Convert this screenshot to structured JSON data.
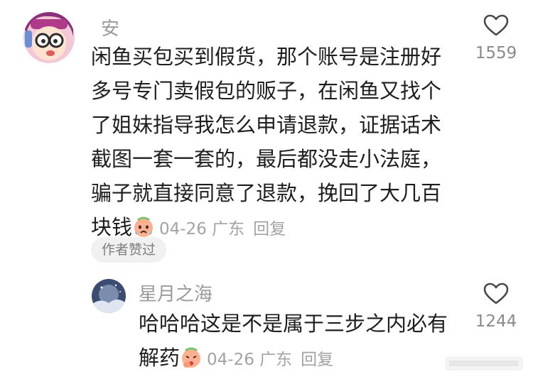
{
  "comments": [
    {
      "username": "安",
      "text_lines": [
        "闲鱼买包买到假货，那个账号是注册好",
        "多号专门卖假包的贩子，在闲鱼又找个",
        "了姐妹指导我怎么申请退款，证据话术",
        "截图一套一套的，最后都没走小法庭，",
        "骗子就直接同意了退款，挽回了大几百",
        "块钱"
      ],
      "emoji": "crying-face-emoji",
      "date": "04-26",
      "location": "广东",
      "reply_label": "回复",
      "likes": "1559",
      "badge": "作者赞过"
    },
    {
      "username": "星月之海",
      "text_lines": [
        "哈哈哈这是不是属于三步之内必有",
        "解药"
      ],
      "emoji": "thinking-face-emoji",
      "date": "04-26",
      "location": "广东",
      "reply_label": "回复",
      "likes": "1244"
    }
  ],
  "icons": {
    "like": "heart-outline-icon"
  },
  "colors": {
    "text": "#1e1e1e",
    "meta": "#a3a3a3",
    "badge_bg": "#f1f1f1",
    "emoji_face": "#ffb08f"
  }
}
